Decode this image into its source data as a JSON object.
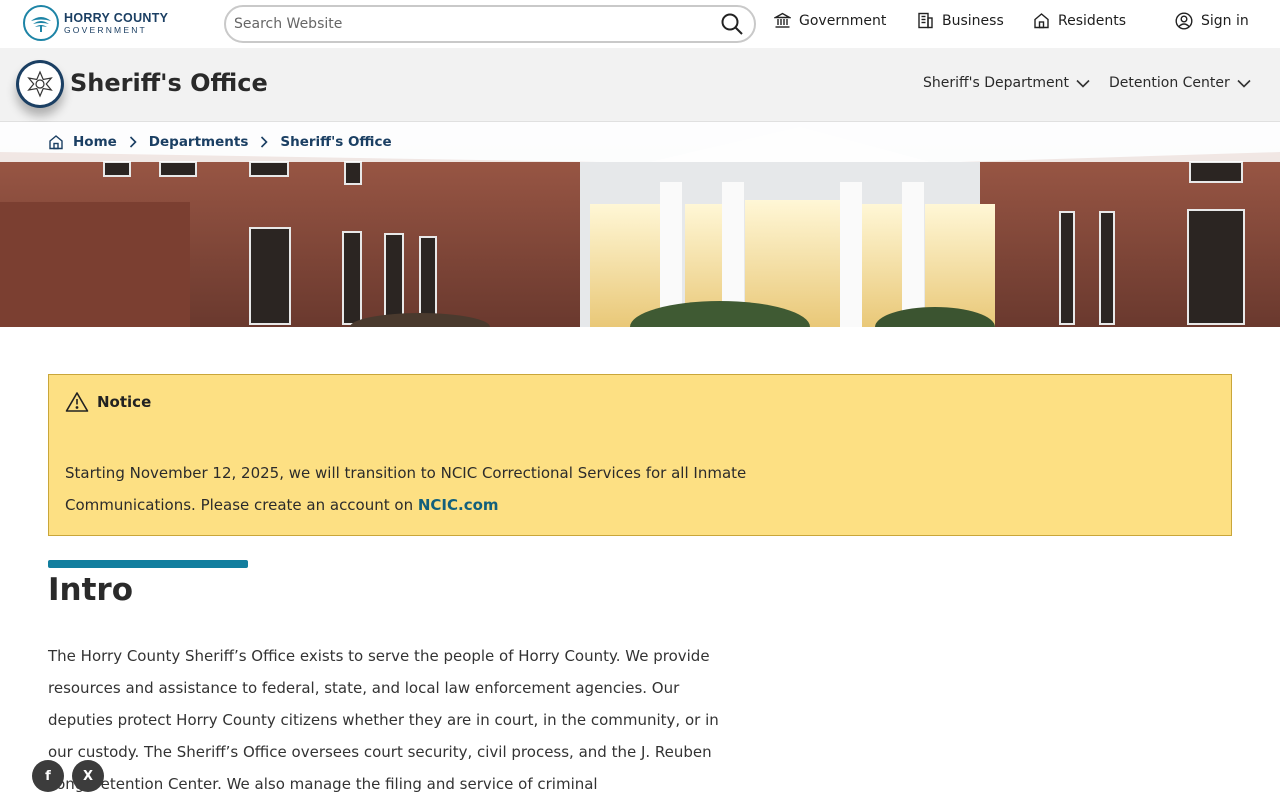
{
  "logo": {
    "line1": "HORRY COUNTY",
    "line2": "GOVERNMENT"
  },
  "search": {
    "placeholder": "Search Website"
  },
  "topnav": {
    "government": "Government",
    "business": "Business",
    "residents": "Residents",
    "signin": "Sign in"
  },
  "department": {
    "title": "Sheriff's Office",
    "nav": [
      "Sheriff's Department",
      "Detention Center"
    ]
  },
  "breadcrumb": [
    "Home",
    "Departments",
    "Sheriff's Office"
  ],
  "notice": {
    "heading": "Notice",
    "body": "Starting November 12, 2025, we will transition to NCIC Correctional Services for all Inmate Communications. Please create an account on",
    "link": "NCIC.com"
  },
  "intro": {
    "title": "Intro",
    "body": "The Horry County Sheriff’s Office exists to serve the people of Horry County. We provide resources and assistance to federal, state, and local law enforcement agencies. Our deputies protect Horry County citizens whether they are in court, in the community, or in our custody. The Sheriff’s Office oversees court security, civil process, and the J. Reuben Long Detention Center. We also manage the filing and service of criminal"
  },
  "social": {
    "facebook": "f",
    "x": "X"
  },
  "colors": {
    "brand_navy": "#1b3f63",
    "brand_teal": "#127e9e",
    "notice_bg": "#fde083",
    "link": "#12607c"
  }
}
